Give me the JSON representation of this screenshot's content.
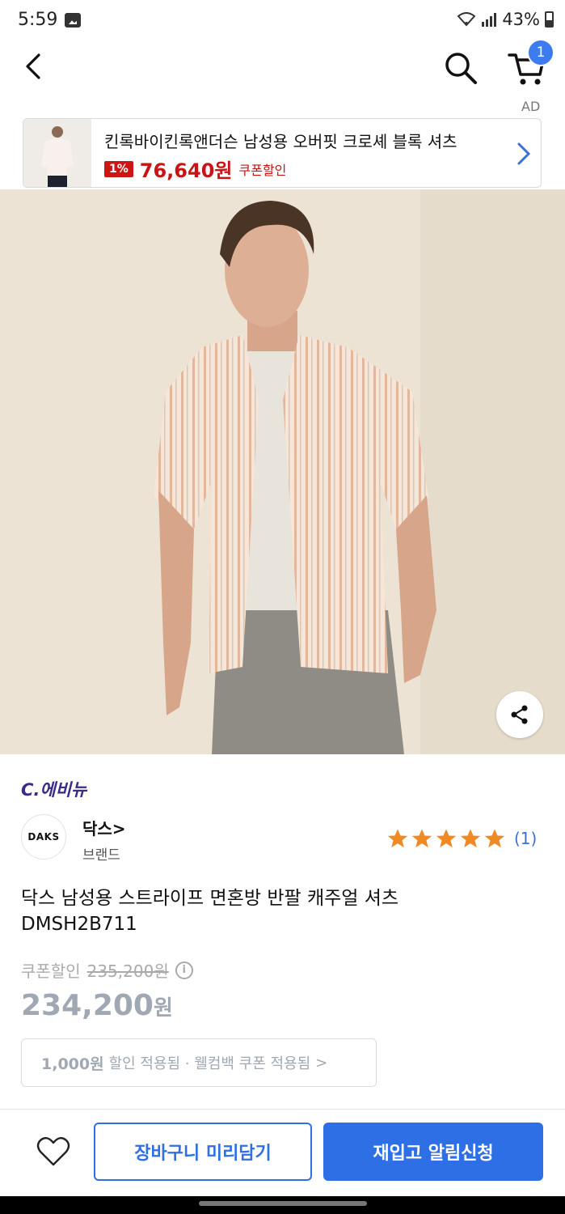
{
  "status": {
    "time": "5:59",
    "battery": "43%"
  },
  "topbar": {
    "cart_count": "1"
  },
  "ad": {
    "label": "AD",
    "title": "킨록바이킨록앤더슨 남성용 오버핏 크로셰 블록 셔츠",
    "discount": "1%",
    "price": "76,640원",
    "coupon_text": "쿠폰할인"
  },
  "seller": {
    "name": "C.에비뉴"
  },
  "brand": {
    "logo_text": "DAKS",
    "name": "닥스>",
    "sub": "브랜드"
  },
  "rating": {
    "stars": 5,
    "count": "(1)"
  },
  "product": {
    "title_line1": "닥스 남성용 스트라이프 면혼방 반팔 캐주얼 셔츠",
    "title_line2": "DMSH2B711"
  },
  "pricing": {
    "coupon_label": "쿠폰할인",
    "original_price": "235,200원",
    "final_price": "234,200",
    "currency": "원"
  },
  "benefit": {
    "amount": "1,000원",
    "text": "할인 적용됨 · 웰컴백 쿠폰 적용됨",
    "chevron": ">"
  },
  "actions": {
    "cart_button": "장바구니 미리담기",
    "notify_button": "재입고 알림신청"
  },
  "colors": {
    "accent": "#2f6fe6",
    "sale": "#c81414",
    "seller": "#3b2a86",
    "star": "#f08a24"
  }
}
